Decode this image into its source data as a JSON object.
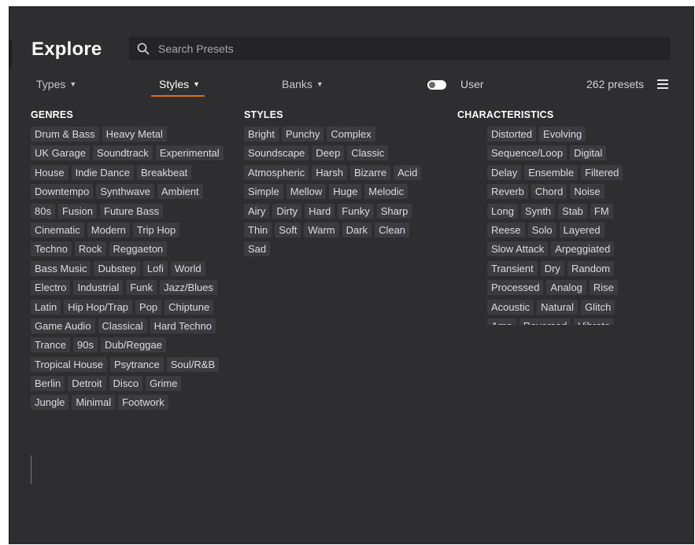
{
  "header": {
    "title": "Explore",
    "search_placeholder": "Search Presets"
  },
  "filters": {
    "types_label": "Types",
    "styles_label": "Styles",
    "banks_label": "Banks",
    "user_label": "User",
    "user_toggle_on": false,
    "preset_count": "262 presets"
  },
  "colors": {
    "accent": "#d6701e",
    "background": "#2e2e31",
    "tag_background": "#3c3c40"
  },
  "genres": {
    "title": "GENRES",
    "rows": [
      [
        "Drum & Bass",
        "Heavy Metal"
      ],
      [
        "UK Garage",
        "Soundtrack",
        "Experimental"
      ],
      [
        "House",
        "Indie Dance",
        "Breakbeat"
      ],
      [
        "Downtempo",
        "Synthwave",
        "Ambient"
      ],
      [
        "80s",
        "Fusion",
        "Future Bass"
      ],
      [
        "Cinematic",
        "Modern",
        "Trip Hop"
      ],
      [
        "Techno",
        "Rock",
        "Reggaeton"
      ],
      [
        "Bass Music",
        "Dubstep",
        "Lofi",
        "World"
      ],
      [
        "Electro",
        "Industrial",
        "Funk",
        "Jazz/Blues"
      ],
      [
        "Latin",
        "Hip Hop/Trap",
        "Pop",
        "Chiptune"
      ],
      [
        "Game Audio",
        "Classical",
        "Hard Techno"
      ],
      [
        "Trance",
        "90s",
        "Dub/Reggae"
      ],
      [
        "Tropical House",
        "Psytrance",
        "Soul/R&B"
      ],
      [
        "Berlin",
        "Detroit",
        "Disco",
        "Grime"
      ],
      [
        "Jungle",
        "Minimal",
        "Footwork"
      ]
    ]
  },
  "styles": {
    "title": "STYLES",
    "rows": [
      [
        "Bright",
        "Punchy",
        "Complex"
      ],
      [
        "Soundscape",
        "Deep",
        "Classic"
      ],
      [
        "Atmospheric",
        "Harsh",
        "Bizarre",
        "Acid"
      ],
      [
        "Simple",
        "Mellow",
        "Huge",
        "Melodic"
      ],
      [
        "Airy",
        "Dirty",
        "Hard",
        "Funky",
        "Sharp"
      ],
      [
        "Thin",
        "Soft",
        "Warm",
        "Dark",
        "Clean"
      ],
      [
        "Sad"
      ]
    ]
  },
  "characteristics": {
    "title": "CHARACTERISTICS",
    "rows": [
      [
        "Distorted",
        "Evolving"
      ],
      [
        "Sequence/Loop",
        "Digital"
      ],
      [
        "Delay",
        "Ensemble",
        "Filtered"
      ],
      [
        "Reverb",
        "Chord",
        "Noise"
      ],
      [
        "Long",
        "Synth",
        "Stab",
        "FM"
      ],
      [
        "Reese",
        "Solo",
        "Layered"
      ],
      [
        "Slow Attack",
        "Arpeggiated"
      ],
      [
        "Transient",
        "Dry",
        "Random"
      ],
      [
        "Processed",
        "Analog",
        "Rise"
      ],
      [
        "Acoustic",
        "Natural",
        "Glitch"
      ],
      [
        "Amp",
        "Reversed",
        "Vibrato"
      ]
    ]
  }
}
